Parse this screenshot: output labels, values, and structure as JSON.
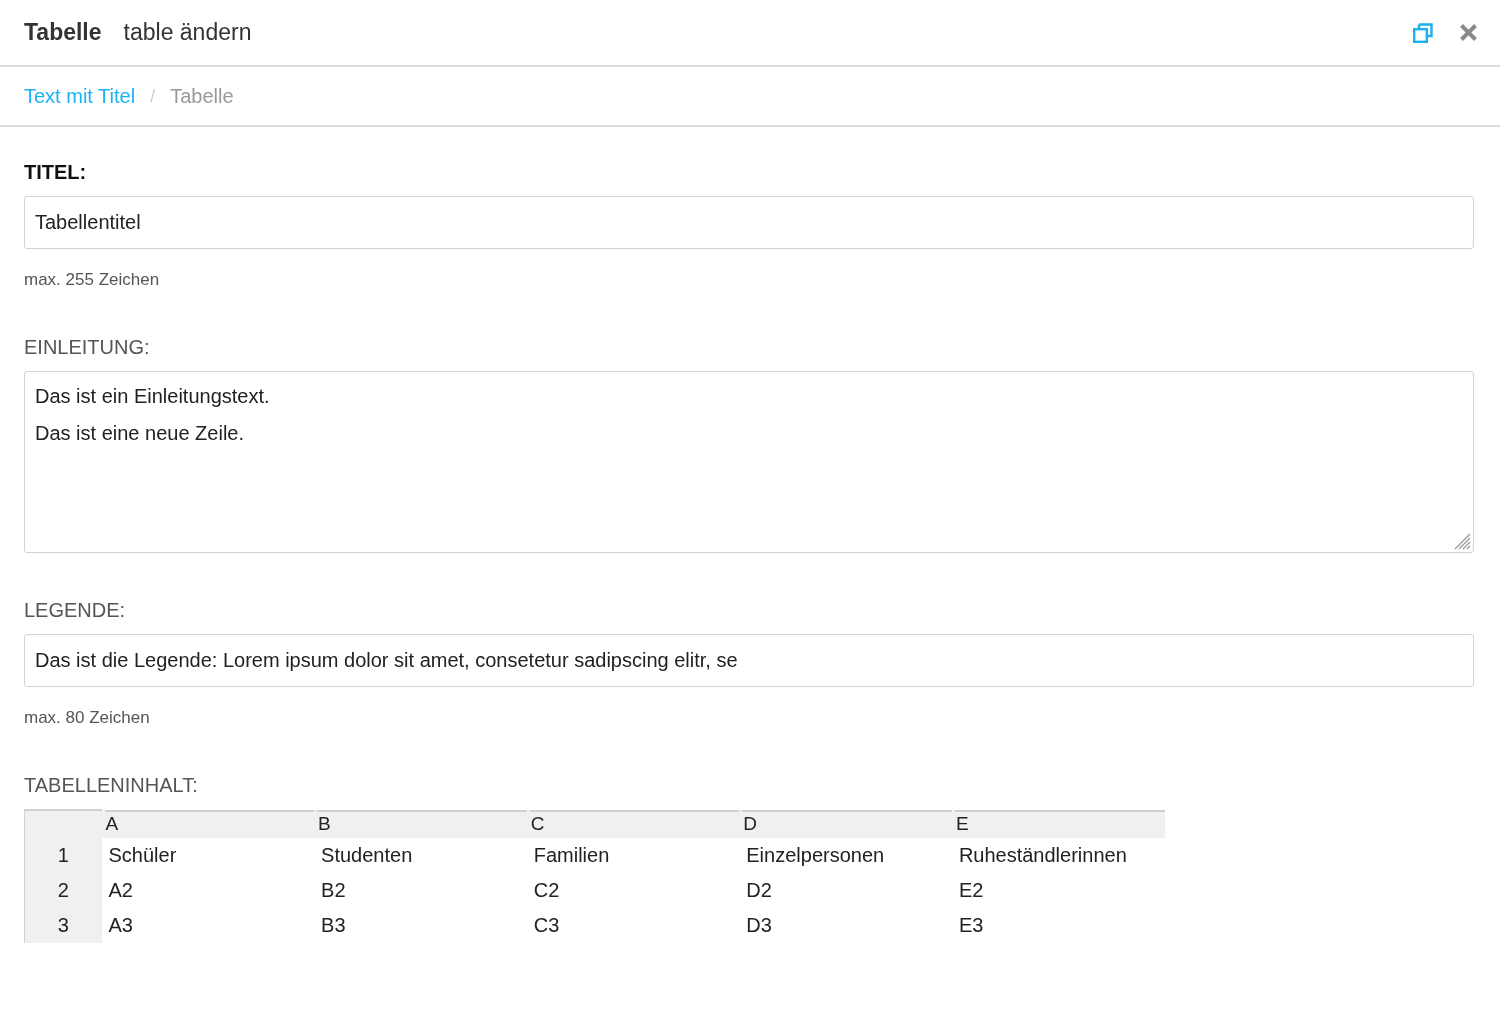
{
  "dialog": {
    "title": "Tabelle",
    "subtitle": "table ändern"
  },
  "breadcrumb": {
    "separator": "/",
    "items": [
      {
        "label": "Text mit Titel",
        "current": false
      },
      {
        "label": "Tabelle",
        "current": true
      }
    ]
  },
  "fields": [
    {
      "kind": "input",
      "label": "TITEL:",
      "required": true,
      "value": "Tabellentitel",
      "hint": "max. 255 Zeichen"
    },
    {
      "kind": "textarea",
      "label": "EINLEITUNG:",
      "required": false,
      "value": "Das ist ein Einleitungstext.\nDas ist eine neue Zeile."
    },
    {
      "kind": "input",
      "label": "LEGENDE:",
      "required": false,
      "value": "Das ist die Legende: Lorem ipsum dolor sit amet, consetetur sadipscing elitr, se",
      "hint": "max. 80 Zeichen"
    },
    {
      "kind": "table",
      "label": "TABELLENINHALT:",
      "required": false,
      "columns": [
        "A",
        "B",
        "C",
        "D",
        "E"
      ],
      "rows": [
        {
          "number": "1",
          "cells": [
            "Schüler",
            "Studenten",
            "Familien",
            "Einzelpersonen",
            "Ruheständlerinnen"
          ]
        },
        {
          "number": "2",
          "cells": [
            "A2",
            "B2",
            "C2",
            "D2",
            "E2"
          ]
        },
        {
          "number": "3",
          "cells": [
            "A3",
            "B3",
            "C3",
            "D3",
            "E3"
          ]
        }
      ]
    }
  ]
}
